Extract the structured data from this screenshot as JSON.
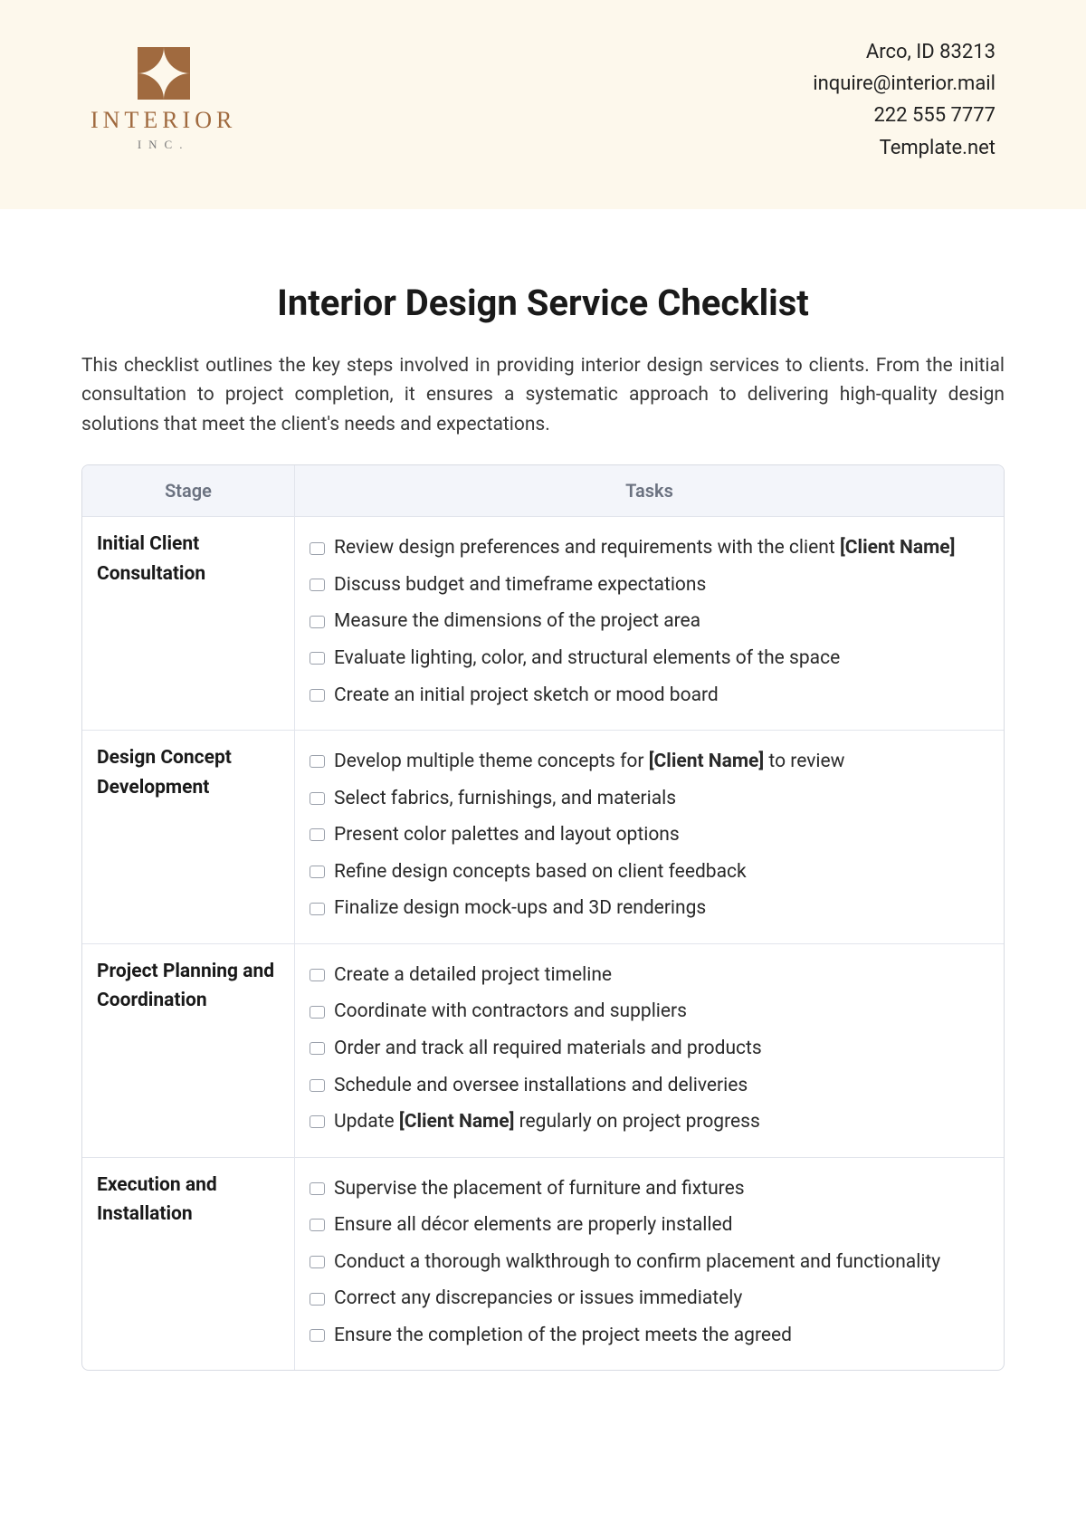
{
  "header": {
    "logo_name": "INTERIOR",
    "logo_sub": "INC.",
    "contact": {
      "address": "Arco, ID 83213",
      "email": "inquire@interior.mail",
      "phone": "222 555 7777",
      "site": "Template.net"
    }
  },
  "title": "Interior Design Service Checklist",
  "intro": "This checklist outlines the key steps involved in providing interior design services to clients. From the initial consultation to project completion, it ensures a systematic approach to delivering high-quality design solutions that meet the client's needs and expectations.",
  "table": {
    "col_stage": "Stage",
    "col_tasks": "Tasks",
    "rows": [
      {
        "stage": "Initial Client Consultation",
        "tasks": [
          "Review design preferences and requirements with the client <b>[Client Name]</b>",
          "Discuss budget and timeframe expectations",
          "Measure the dimensions of the project area",
          "Evaluate lighting, color, and structural elements of the space",
          "Create an initial project sketch or mood board"
        ]
      },
      {
        "stage": "Design Concept Development",
        "tasks": [
          "Develop multiple theme concepts for <b>[Client Name]</b> to review",
          "Select fabrics, furnishings, and materials",
          "Present color palettes and layout options",
          "Refine design concepts based on client feedback",
          "Finalize design mock-ups and 3D renderings"
        ]
      },
      {
        "stage": "Project Planning and Coordination",
        "tasks": [
          "Create a detailed project timeline",
          "Coordinate with contractors and suppliers",
          "Order and track all required materials and products",
          "Schedule and oversee installations and deliveries",
          "Update <b>[Client Name]</b> regularly on project progress"
        ]
      },
      {
        "stage": "Execution and Installation",
        "tasks": [
          "Supervise the placement of furniture and fixtures",
          "Ensure all décor elements are properly installed",
          "Conduct a thorough walkthrough to confirm placement and functionality",
          "Correct any discrepancies or issues immediately",
          "Ensure the completion of the project meets the agreed"
        ]
      }
    ]
  }
}
